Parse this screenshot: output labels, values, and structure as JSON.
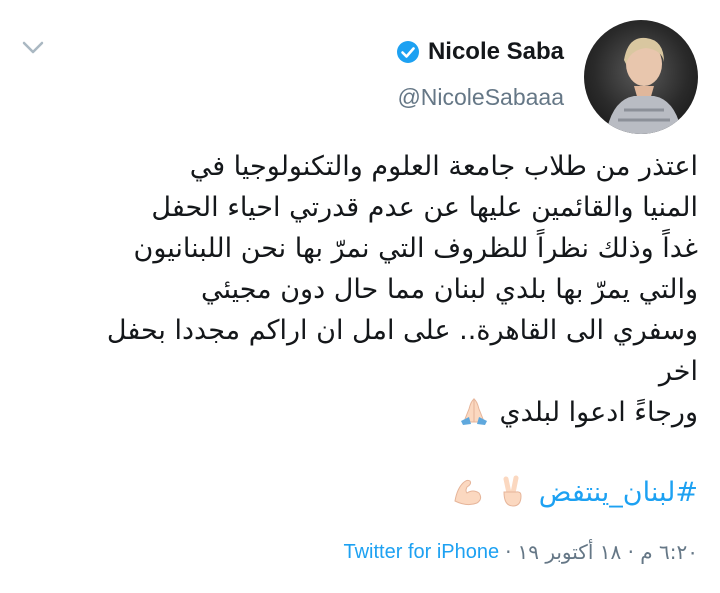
{
  "tweet": {
    "display_name": "Nicole Saba",
    "handle": "@NicoleSabaaa",
    "lines": [
      "اعتذر من طلاب جامعة العلوم والتكنولوجيا في",
      "المنيا والقائمين عليها عن عدم قدرتي احياء الحفل",
      "غداً وذلك نظراً للظروف التي نمرّ بها نحن اللبنانيون",
      "والتي يمرّ بها بلدي لبنان مما حال دون مجيئي",
      "وسفري الى القاهرة.. على امل ان اراكم مجددا بحفل",
      "اخر",
      "ورجاءً ادعوا لبلدي"
    ],
    "hashtag": "#لبنان_ينتفض",
    "source": "Twitter for iPhone",
    "separator": "·",
    "timestamp": "٦:٢٠ م · ١٨ أكتوبر ١٩",
    "icons": {
      "menu": "chevron-down-icon",
      "verified": "verified-badge-icon",
      "pray": "folded-hands-emoji",
      "peace": "victory-hand-emoji",
      "muscle": "flexed-biceps-emoji"
    },
    "colors": {
      "link": "#1da1f2",
      "secondary": "#657786",
      "text": "#14171a"
    }
  }
}
